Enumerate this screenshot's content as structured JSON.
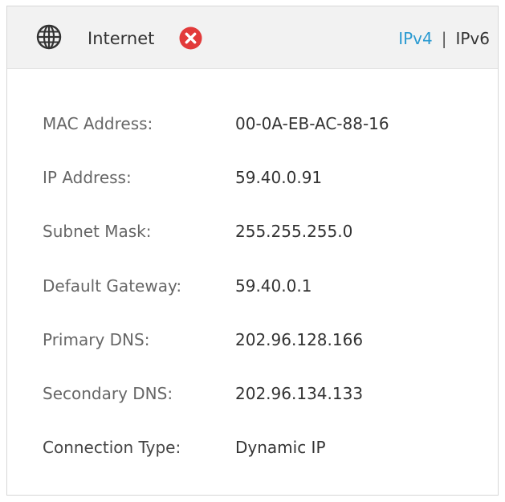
{
  "header": {
    "title": "Internet",
    "globe_icon": "globe-icon",
    "status_icon": "error-x-icon",
    "status_color": "#e23a3a",
    "ipv4_label": "IPv4",
    "separator": "|",
    "ipv6_label": "IPv6",
    "active_color": "#2a9ad1"
  },
  "details": [
    {
      "label": "MAC Address:",
      "value": "00-0A-EB-AC-88-16"
    },
    {
      "label": "IP Address:",
      "value": "59.40.0.91"
    },
    {
      "label": "Subnet Mask:",
      "value": "255.255.255.0"
    },
    {
      "label": "Default Gateway:",
      "value": "59.40.0.1"
    },
    {
      "label": "Primary DNS:",
      "value": "202.96.128.166"
    },
    {
      "label": "Secondary DNS:",
      "value": "202.96.134.133"
    },
    {
      "label": "Connection Type:",
      "value": "Dynamic IP"
    }
  ]
}
